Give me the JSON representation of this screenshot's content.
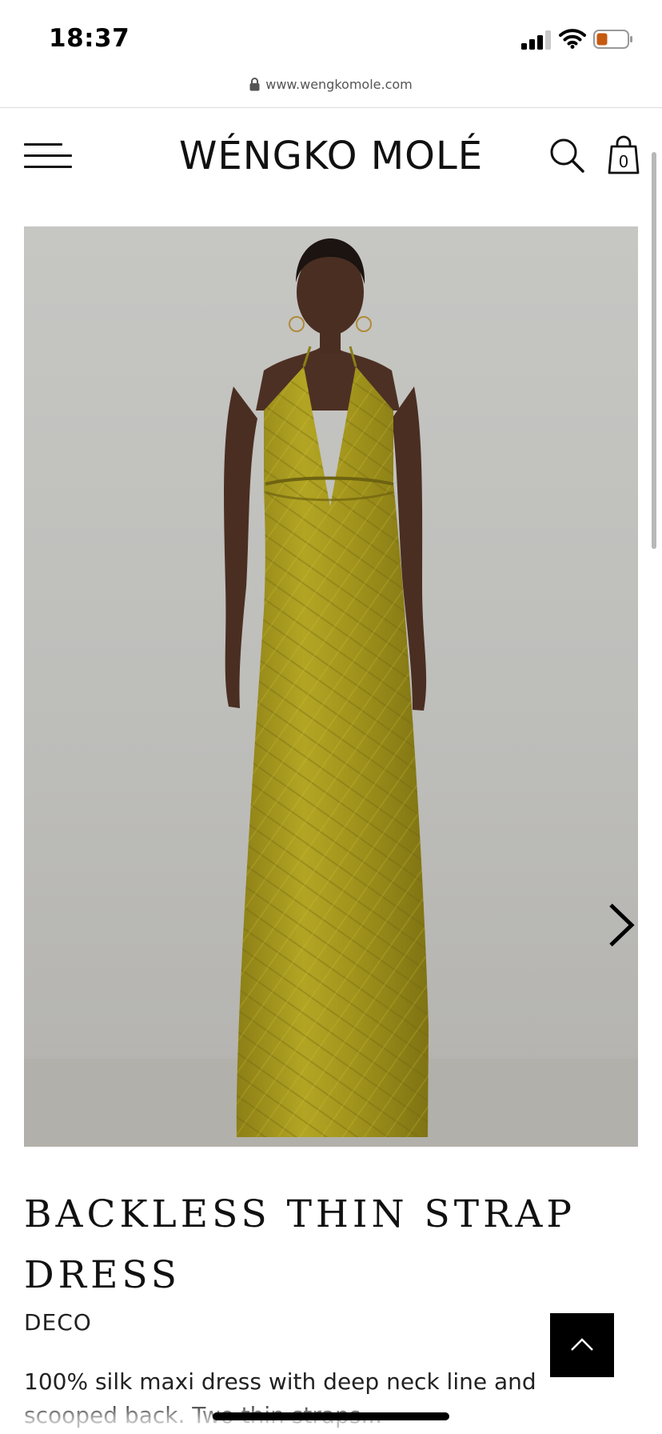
{
  "status_bar": {
    "time": "18:37"
  },
  "browser": {
    "url": "www.wengkomole.com"
  },
  "header": {
    "logo": "WÉNGKO MOLÉ",
    "cart_count": "0"
  },
  "product": {
    "image": {
      "alt": "Model wearing yellow-green patterned silk backless thin strap maxi dress"
    },
    "title": "BACKLESS THIN STRAP DRESS",
    "collection": "DECO",
    "description": "100% silk maxi dress with deep neck line and scooped back. Two thin straps..."
  },
  "colors": {
    "dress": "#a89a1c",
    "background": "#c1c1be",
    "accent": "#000000"
  },
  "icons": [
    "lock-icon",
    "menu-icon",
    "search-icon",
    "shopping-bag-icon",
    "chevron-right-icon",
    "chevron-up-icon"
  ]
}
